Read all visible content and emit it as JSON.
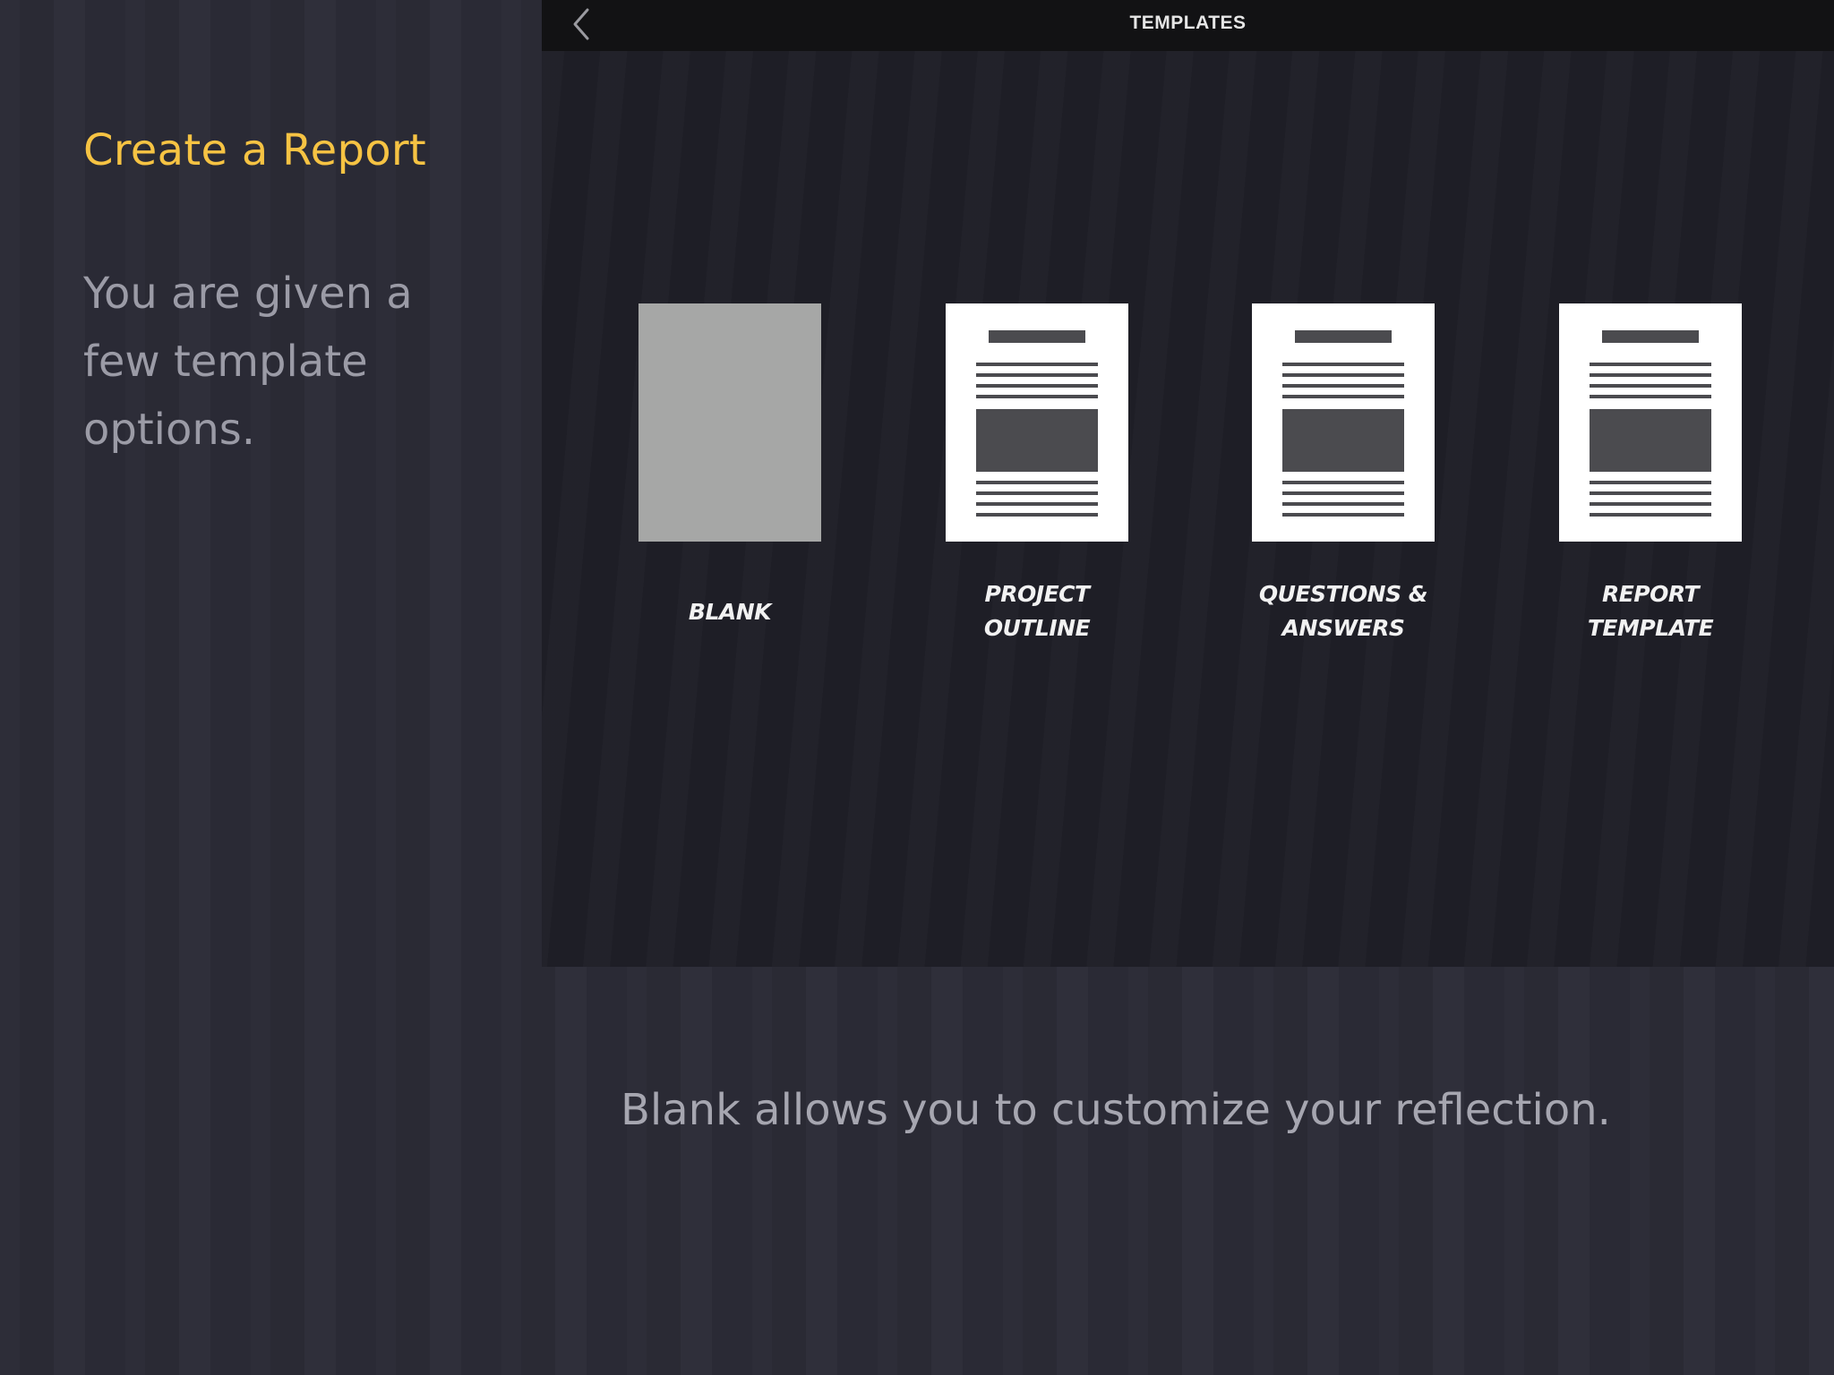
{
  "slide": {
    "title": "Create a Report",
    "body": "You are given a few template options.",
    "caption": "Blank allows you to customize your reflection."
  },
  "app": {
    "nav_title": "TEMPLATES",
    "back_icon": "chevron-left-icon",
    "templates": [
      {
        "id": "blank",
        "label_lines": [
          "BLANK"
        ]
      },
      {
        "id": "project-outline",
        "label_lines": [
          "PROJECT",
          "OUTLINE"
        ]
      },
      {
        "id": "questions-answers",
        "label_lines": [
          "QUESTIONS &",
          "ANSWERS"
        ]
      },
      {
        "id": "report-template",
        "label_lines": [
          "REPORT",
          "TEMPLATE"
        ]
      }
    ]
  },
  "colors": {
    "accent": "#f6c343",
    "background": "#2b2b36",
    "app_background": "#1f1f28",
    "nav_bar": "#121214",
    "blank_thumbnail": "#a6a7a6",
    "doc_marks": "#4b4b4f"
  }
}
